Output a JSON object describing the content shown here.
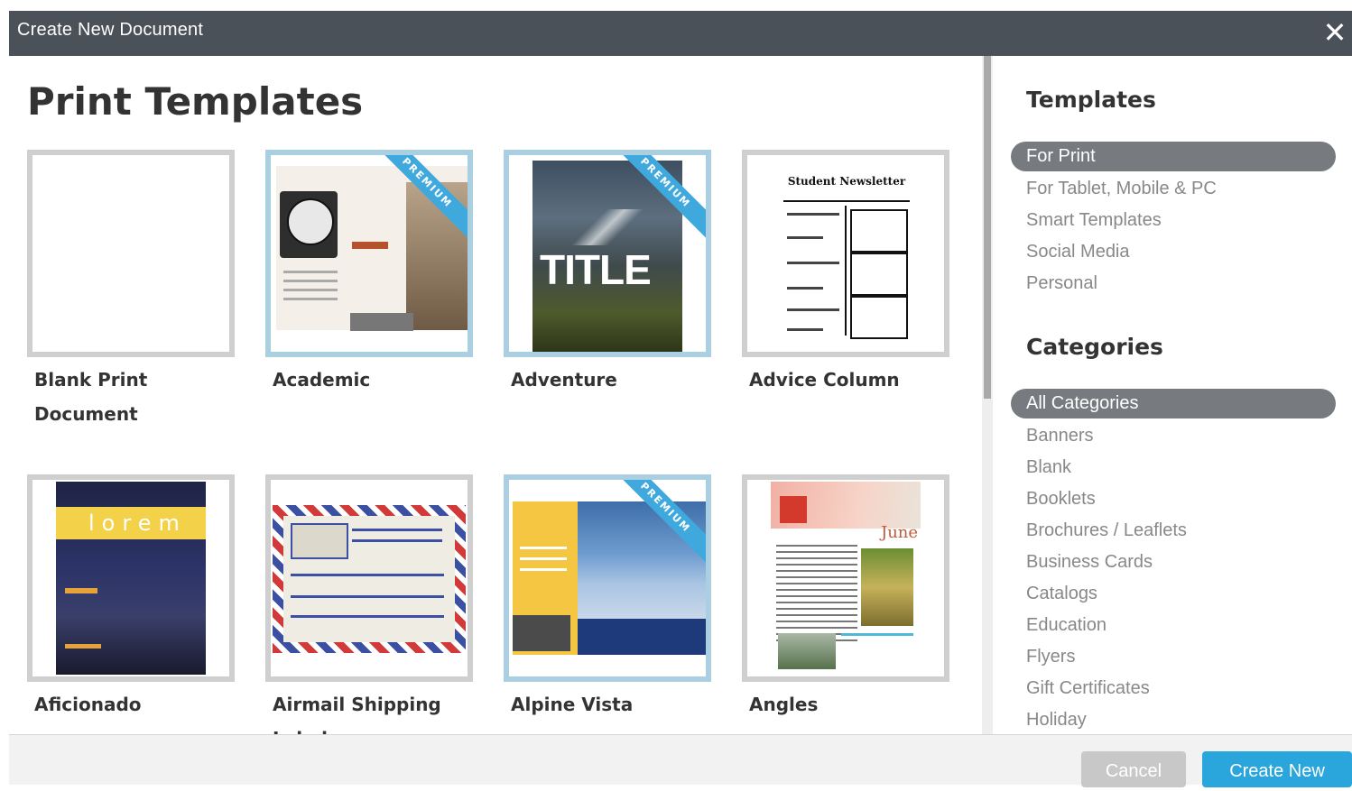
{
  "window": {
    "title": "Create New Document",
    "close_icon": "close-icon"
  },
  "main": {
    "title": "Print Templates",
    "premium_badge": "PREMIUM",
    "templates": [
      {
        "label": "Blank Print Document",
        "premium": false
      },
      {
        "label": "Academic",
        "premium": true
      },
      {
        "label": "Adventure",
        "premium": true
      },
      {
        "label": "Advice Column",
        "premium": false
      },
      {
        "label": "Aficionado",
        "premium": false
      },
      {
        "label": "Airmail Shipping Label",
        "premium": false
      },
      {
        "label": "Alpine Vista",
        "premium": true
      },
      {
        "label": "Angles",
        "premium": false
      }
    ],
    "thumb_text": {
      "adventure_title": "TITLE",
      "advice_masthead": "Student Newsletter",
      "aficionado_word": "lorem",
      "angles_month": "June"
    }
  },
  "sidebar": {
    "templates_heading": "Templates",
    "templates": [
      "For Print",
      "For Tablet, Mobile & PC",
      "Smart Templates",
      "Social Media",
      "Personal"
    ],
    "templates_selected": "For Print",
    "categories_heading": "Categories",
    "categories": [
      "All Categories",
      "Banners",
      "Blank",
      "Booklets",
      "Brochures / Leaflets",
      "Business Cards",
      "Catalogs",
      "Education",
      "Flyers",
      "Gift Certificates",
      "Holiday"
    ],
    "categories_selected": "All Categories"
  },
  "footer": {
    "cancel_label": "Cancel",
    "create_label": "Create New"
  },
  "colors": {
    "titlebar": "#4b5158",
    "accent": "#2aa6dc",
    "premium_ribbon": "#3fa9dd",
    "premium_border": "#a9cfe1",
    "pill": "#777b80"
  }
}
